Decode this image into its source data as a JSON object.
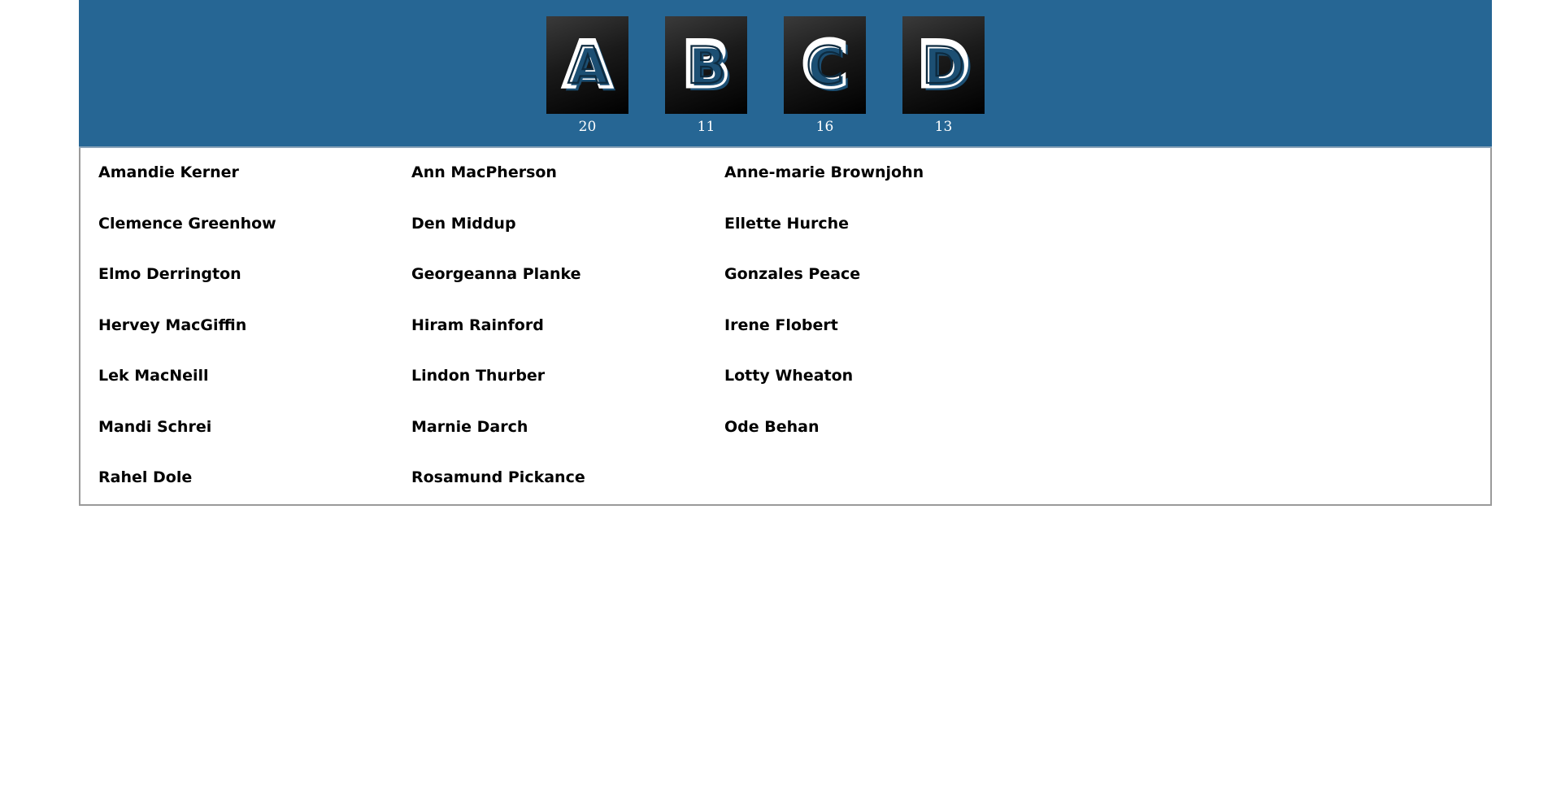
{
  "letters": [
    {
      "glyph": "A",
      "count": "20"
    },
    {
      "glyph": "B",
      "count": "11"
    },
    {
      "glyph": "C",
      "count": "16"
    },
    {
      "glyph": "D",
      "count": "13"
    }
  ],
  "names": [
    "Amandie Kerner",
    "Ann MacPherson",
    "Anne-marie Brownjohn",
    "Clemence Greenhow",
    "Den Middup",
    "Ellette Hurche",
    "Elmo Derrington",
    "Georgeanna Planke",
    "Gonzales Peace",
    "Hervey MacGiffin",
    "Hiram Rainford",
    "Irene Flobert",
    "Lek MacNeill",
    "Lindon Thurber",
    "Lotty Wheaton",
    "Mandi Schrei",
    "Marnie Darch",
    "Ode Behan",
    "Rahel Dole",
    "Rosamund Pickance"
  ],
  "colors": {
    "header_bg": "#266694",
    "tile_bg": "#000000",
    "letter_shadow": "#1c4f73"
  }
}
